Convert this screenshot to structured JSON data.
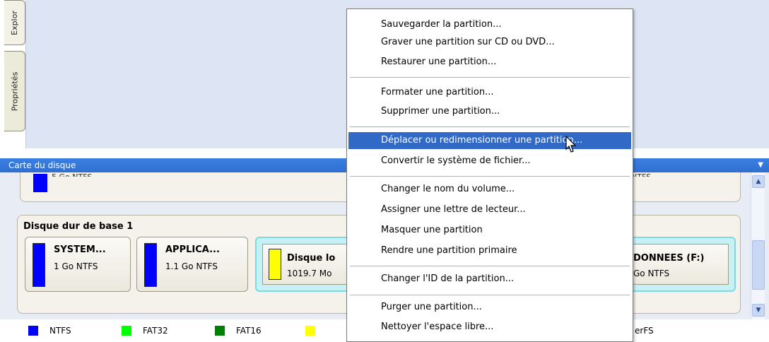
{
  "side_tabs": {
    "explorer": "Explor",
    "properties": "Propriétés"
  },
  "diskmap": {
    "title": "Carte du disque",
    "top_partial_left": "5 Go NTFS",
    "top_partial_right": "NTFS",
    "disk": {
      "title": "Disque dur de base 1",
      "partitions": [
        {
          "name": "SYSTEM...",
          "info": "1 Go NTFS",
          "color": "#0000ff"
        },
        {
          "name": "APPLICA...",
          "info": "1.1 Go NTFS",
          "color": "#0000ff"
        },
        {
          "name": "Disque lo",
          "info": "1019.7 Mo",
          "color": "#ffff00"
        },
        {
          "name": "DONNEES (F:)",
          "info": "Go NTFS"
        }
      ]
    }
  },
  "legend": [
    {
      "label": "NTFS",
      "color": "#0000ff"
    },
    {
      "label": "FAT32",
      "color": "#00ff00"
    },
    {
      "label": "FAT16",
      "color": "#008000"
    },
    {
      "label": "",
      "color": "#ffff00"
    },
    {
      "label": "erFS"
    }
  ],
  "context_menu": {
    "groups": [
      [
        "Sauvegarder la partition...",
        "Graver une partition sur CD ou DVD...",
        "Restaurer une partition..."
      ],
      [
        "Formater une partition...",
        "Supprimer une partition..."
      ],
      [
        "Déplacer ou redimensionner une partition...",
        "Convertir le système de fichier..."
      ],
      [
        "Changer le nom du volume...",
        "Assigner une lettre de lecteur...",
        "Masquer une partition",
        "Rendre une partition primaire"
      ],
      [
        "Changer l'ID de la partition..."
      ],
      [
        "Purger une partition...",
        "Nettoyer l'espace libre..."
      ]
    ],
    "highlighted": "Déplacer ou redimensionner une partition..."
  },
  "icons": {
    "scroll_up": "arrow-up-icon",
    "scroll_down": "arrow-down-icon",
    "collapse": "chevron-down-icon",
    "cursor": "mouse-pointer-icon"
  },
  "colors": {
    "header_blue": "#2f6fd2",
    "menu_highlight": "#3169c6",
    "selected_partition": "#c6f2f6"
  }
}
